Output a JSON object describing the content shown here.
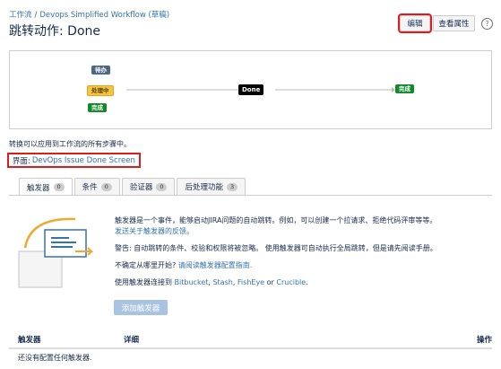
{
  "breadcrumb": {
    "root": "工作流",
    "separator": "/",
    "workflow": "Devops Simplified Workflow (草稿)"
  },
  "page": {
    "title": "跳转动作: Done"
  },
  "header_buttons": {
    "edit": "编辑",
    "view_properties": "查看属性",
    "help": "?"
  },
  "diagram": {
    "statuses": {
      "todo": "待办",
      "in_progress": "处理中",
      "done_left": "完成",
      "transition": "Done",
      "done_right": "完成"
    }
  },
  "info": {
    "applies_text": "转换可以应用到工作流的所有步骤中。",
    "screen_label": "界面:",
    "screen_name": "DevOps Issue Done Screen"
  },
  "tabs": [
    {
      "label": "触发器",
      "count": "0"
    },
    {
      "label": "条件",
      "count": "0"
    },
    {
      "label": "验证器",
      "count": "0"
    },
    {
      "label": "后处理功能",
      "count": "3"
    }
  ],
  "triggers_panel": {
    "desc1": "触发器是一个事件，能够启动JIRA问题的自动跳转。例如，可以创建一个拉请求、拒绝代码评审等等。",
    "desc1_link": "发送关于触发器的反馈。",
    "warning": "警告: 自动跳转的条件、校验和权限将被忽略。 使用触发器可自动执行全局跳转，但是请先阅读手册。",
    "unsure": "不确定从哪里开始?",
    "unsure_link": "请阅读触发器配置指南.",
    "connect_prefix": "使用触发器连接到",
    "bitbucket": "Bitbucket",
    "comma1": ",",
    "stash": "Stash",
    "comma2": ",",
    "fisheye": "FishEye",
    "or": "or",
    "crucible": "Crucible",
    "period": ".",
    "add_button": "添加触发器"
  },
  "table": {
    "headers": {
      "trigger": "触发器",
      "details": "详细",
      "actions": "操作"
    },
    "empty_message": "还没有配置任何触发器."
  },
  "colors": {
    "link": "#3572b0",
    "highlight": "#e01b1b",
    "todo": "#4a6785",
    "progress": "#f6c342",
    "done": "#14892c"
  }
}
